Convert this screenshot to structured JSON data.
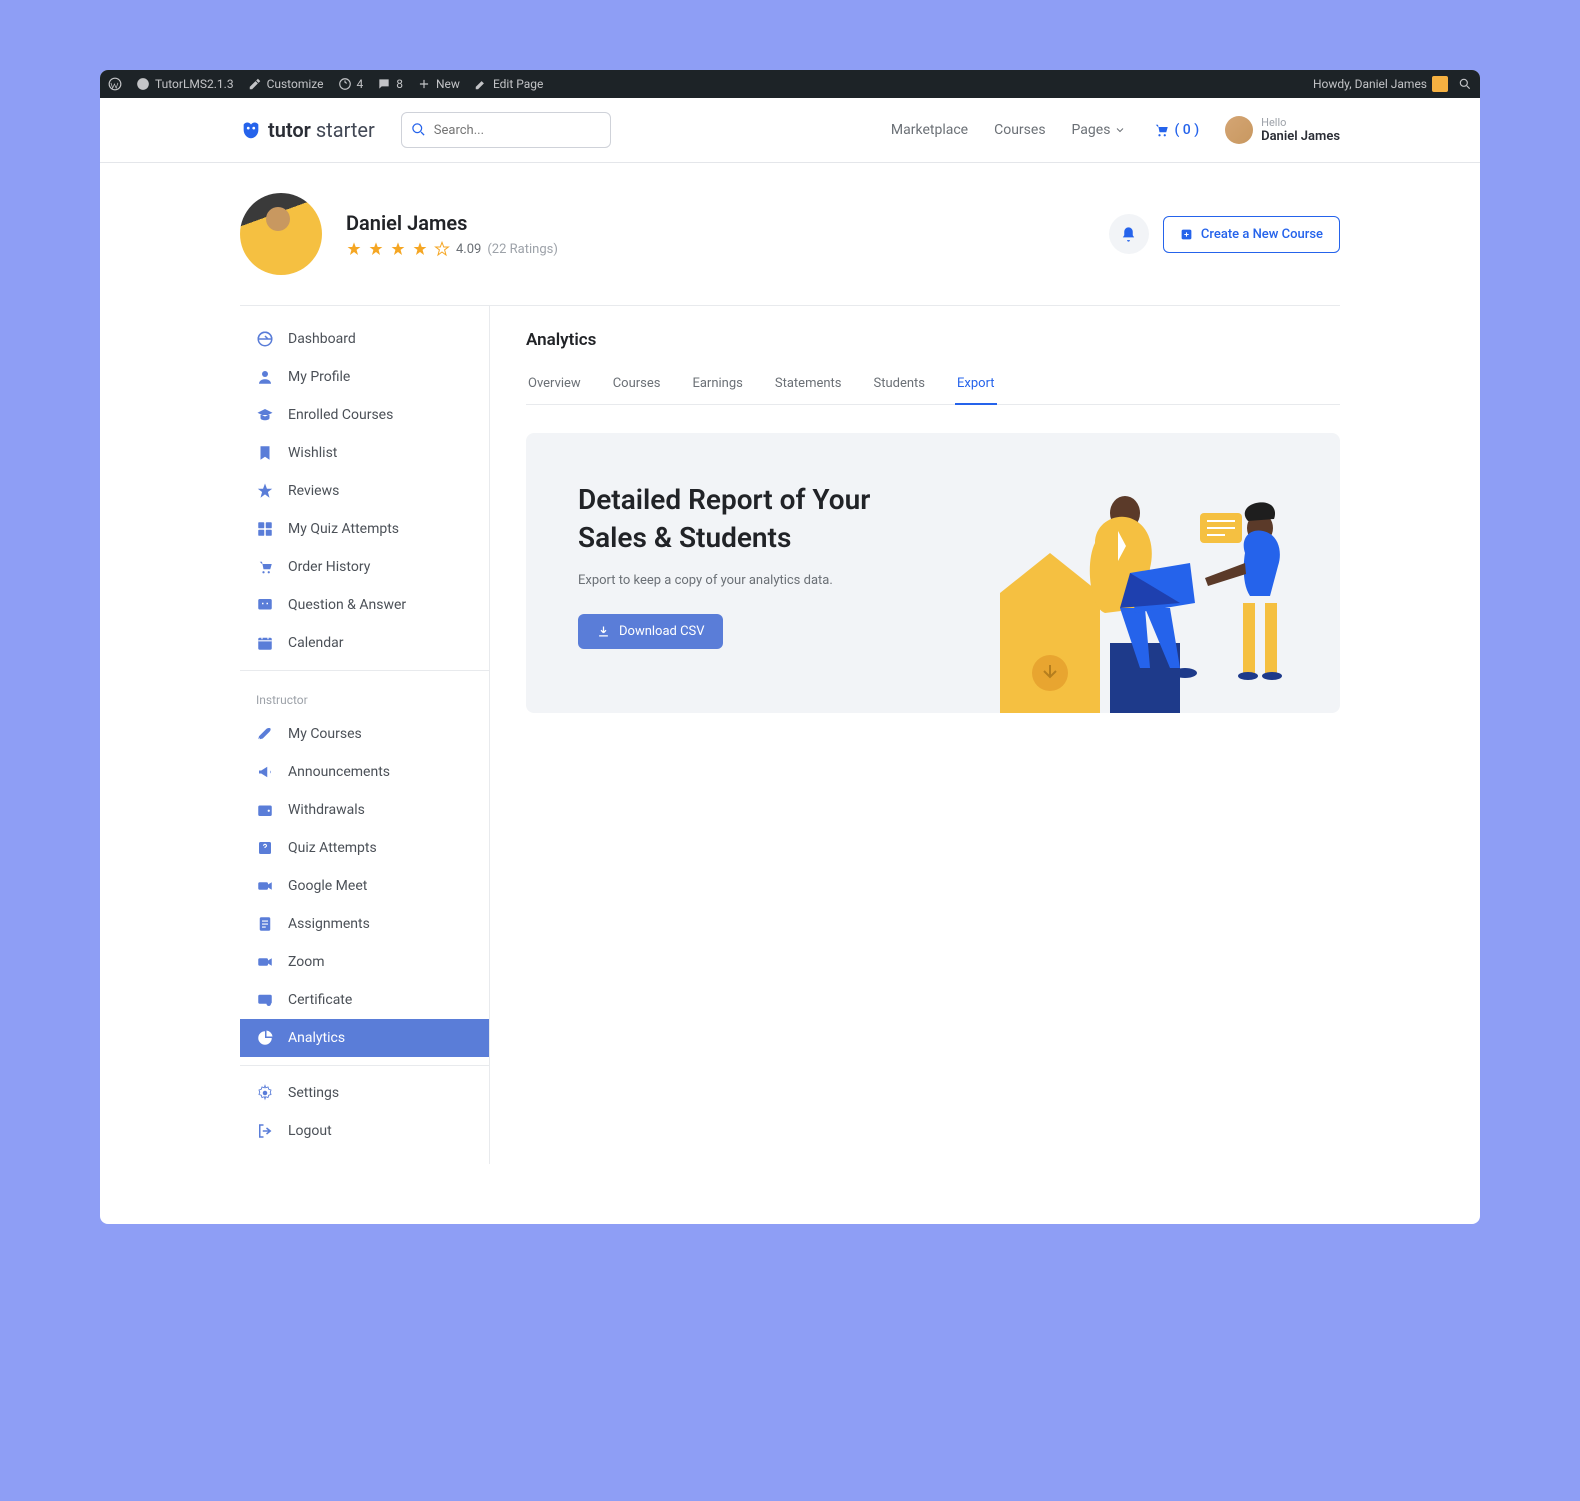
{
  "adminbar": {
    "plugin": "TutorLMS2.1.3",
    "customize": "Customize",
    "updates": "4",
    "comments": "8",
    "new": "New",
    "edit": "Edit Page",
    "howdy": "Howdy, Daniel James"
  },
  "header": {
    "logo1": "tutor",
    "logo2": "starter",
    "search_placeholder": "Search...",
    "nav": {
      "marketplace": "Marketplace",
      "courses": "Courses",
      "pages": "Pages"
    },
    "cart": "( 0 )",
    "user": {
      "hello": "Hello",
      "name": "Daniel James"
    }
  },
  "profile": {
    "name": "Daniel James",
    "rating": "4.09",
    "ratings_count": "(22 Ratings)",
    "create": "Create a New Course"
  },
  "sidebar": {
    "items": [
      {
        "label": "Dashboard"
      },
      {
        "label": "My Profile"
      },
      {
        "label": "Enrolled Courses"
      },
      {
        "label": "Wishlist"
      },
      {
        "label": "Reviews"
      },
      {
        "label": "My Quiz Attempts"
      },
      {
        "label": "Order History"
      },
      {
        "label": "Question & Answer"
      },
      {
        "label": "Calendar"
      }
    ],
    "instructor_label": "Instructor",
    "instructor": [
      {
        "label": "My Courses"
      },
      {
        "label": "Announcements"
      },
      {
        "label": "Withdrawals"
      },
      {
        "label": "Quiz Attempts"
      },
      {
        "label": "Google Meet"
      },
      {
        "label": "Assignments"
      },
      {
        "label": "Zoom"
      },
      {
        "label": "Certificate"
      },
      {
        "label": "Analytics"
      }
    ],
    "footer": [
      {
        "label": "Settings"
      },
      {
        "label": "Logout"
      }
    ]
  },
  "main": {
    "title": "Analytics",
    "tabs": [
      "Overview",
      "Courses",
      "Earnings",
      "Statements",
      "Students",
      "Export"
    ],
    "active_tab": "Export",
    "card": {
      "heading": "Detailed Report of Your Sales & Students",
      "sub": "Export to keep a copy of your analytics data.",
      "button": "Download CSV"
    }
  }
}
